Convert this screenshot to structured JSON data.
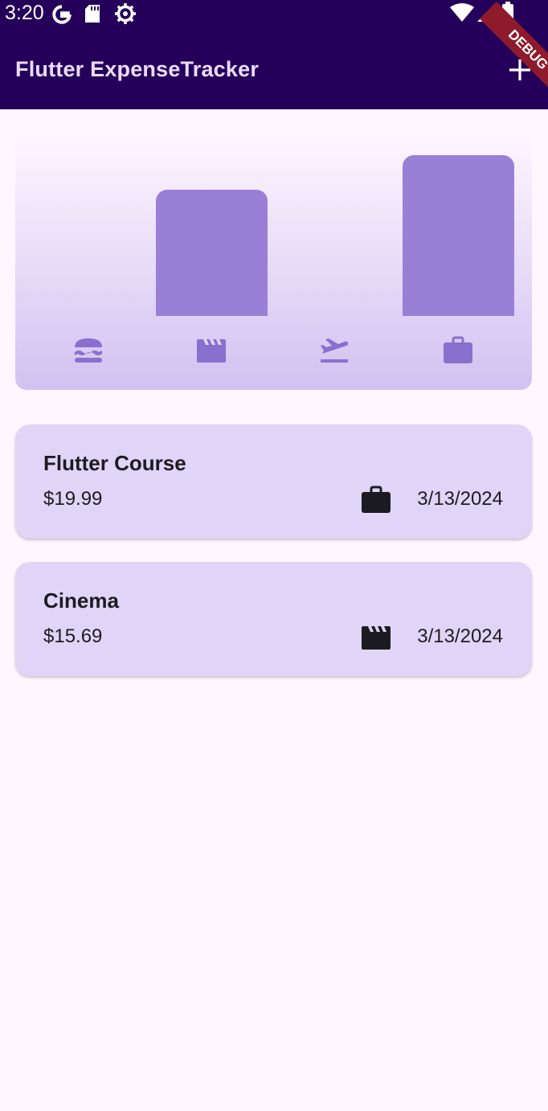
{
  "status_bar": {
    "time": "3:20"
  },
  "app_bar": {
    "title": "Flutter ExpenseTracker",
    "add_icon": "add-icon"
  },
  "debug_banner": "DEBUG",
  "chart": {
    "categories": [
      "food",
      "leisure",
      "travel",
      "work"
    ],
    "category_icons": [
      "burger-icon",
      "movie-icon",
      "flight-takeoff-icon",
      "briefcase-icon"
    ],
    "bucket_totals": [
      0,
      15.69,
      0,
      19.99
    ],
    "bar_color": "#9a7fd6"
  },
  "expenses": [
    {
      "title": "Flutter Course",
      "amount": "$19.99",
      "date": "3/13/2024",
      "category_icon": "briefcase-icon"
    },
    {
      "title": "Cinema",
      "amount": "$15.69",
      "date": "3/13/2024",
      "category_icon": "movie-icon"
    }
  ],
  "colors": {
    "app_bar": "#25005a",
    "app_title": "#eaddff",
    "card_bg": "#e0d5f6",
    "page_bg": "#fef7ff",
    "icon_purple": "#8a6fcf"
  }
}
